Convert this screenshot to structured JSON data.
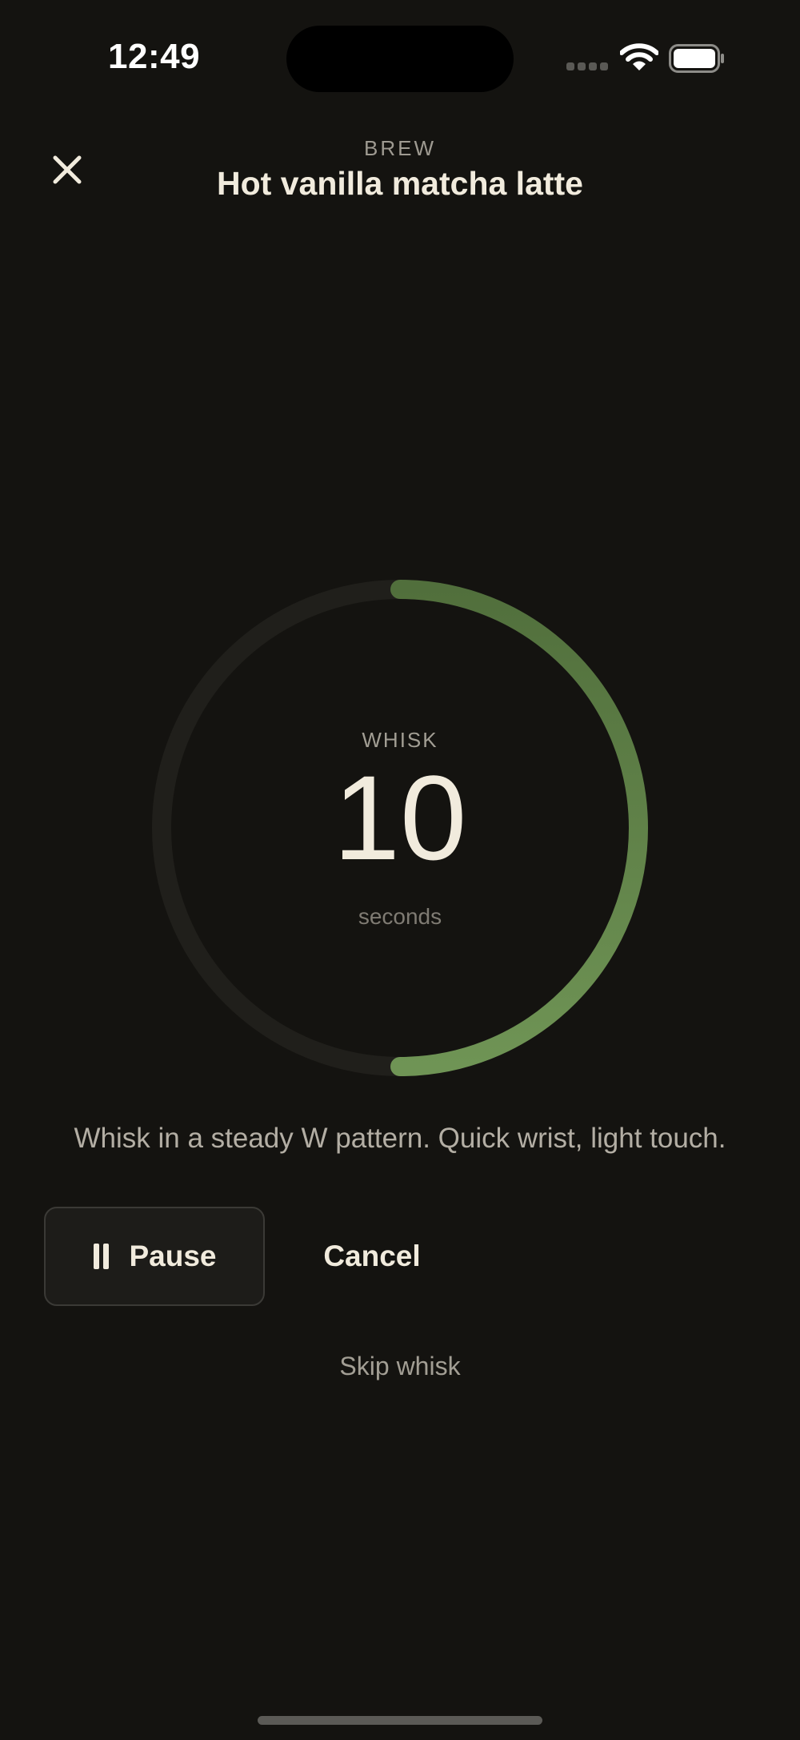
{
  "status_bar": {
    "time": "12:49",
    "icons": [
      "signal-icon",
      "wifi-icon",
      "battery-icon"
    ]
  },
  "header": {
    "close_icon": "close-icon",
    "eyebrow": "BREW",
    "title": "Hot vanilla matcha latte"
  },
  "timer": {
    "label": "WHISK",
    "value": "10",
    "unit": "seconds",
    "progress": 0.5,
    "track_color": "#201f1b",
    "progress_color_start": "#516f3c",
    "progress_color_end": "#6f9455"
  },
  "instruction": "Whisk in a steady W pattern. Quick wrist, light touch.",
  "actions": {
    "pause_icon": "pause-icon",
    "pause_label": "Pause",
    "cancel_label": "Cancel",
    "skip_label": "Skip whisk"
  }
}
